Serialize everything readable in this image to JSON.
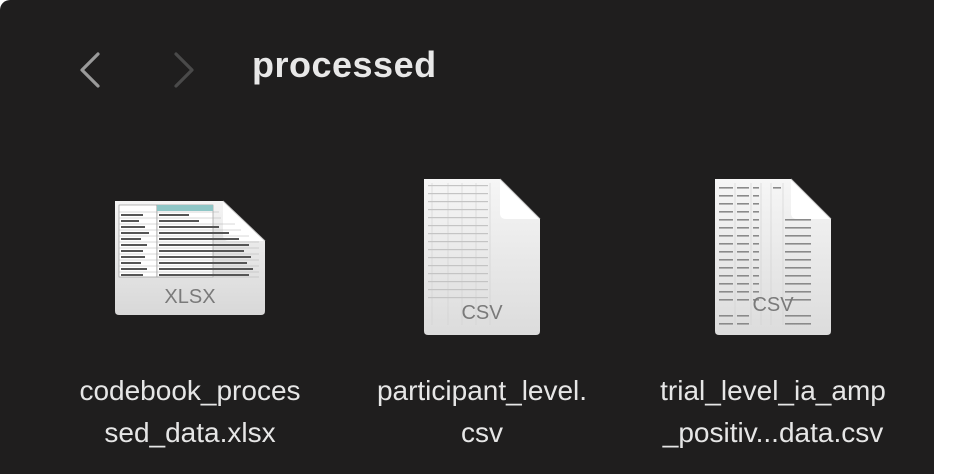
{
  "window": {
    "folder_title": "processed"
  },
  "nav": {
    "back_icon": "chevron-left-icon",
    "forward_icon": "chevron-right-icon"
  },
  "files": [
    {
      "icon": "xlsx-document-icon",
      "badge": "XLSX",
      "name_line1": "codebook_proces",
      "name_line2": "sed_data.xlsx"
    },
    {
      "icon": "csv-document-icon",
      "badge": "CSV",
      "name_line1": "participant_level.",
      "name_line2": "csv"
    },
    {
      "icon": "csv-document-icon",
      "badge": "CSV",
      "name_line1": "trial_level_ia_amp",
      "name_line2": "_positiv...data.csv"
    }
  ],
  "colors": {
    "background": "#1f1e1e",
    "text": "#e6e6e6",
    "nav_enabled": "#9a9a9a",
    "nav_disabled": "#4a4a4a"
  }
}
